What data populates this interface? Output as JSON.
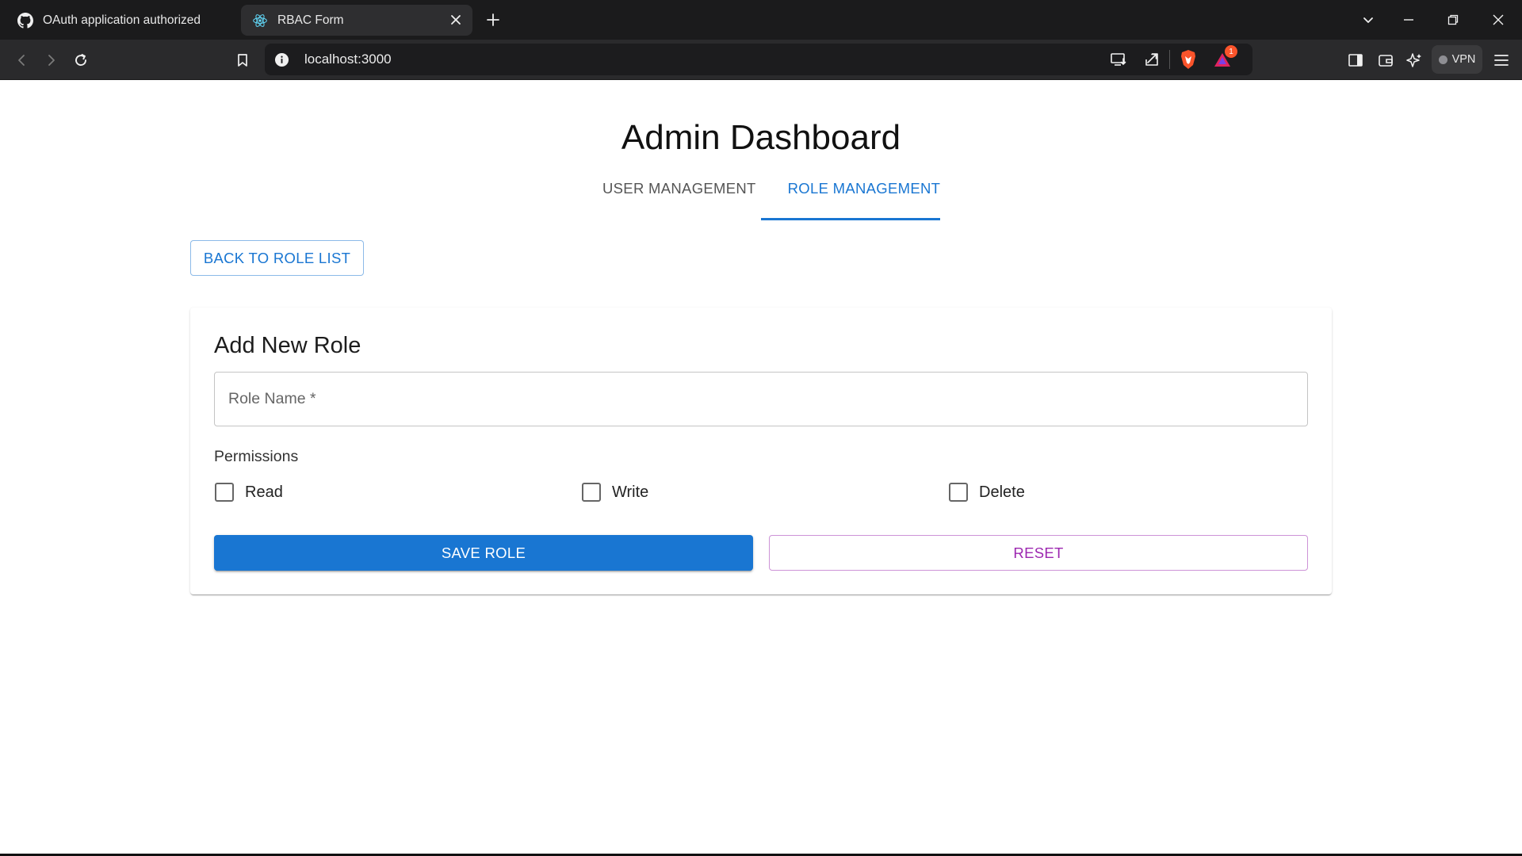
{
  "browser": {
    "tabs": [
      {
        "title": "OAuth application authorized",
        "icon": "github-icon",
        "active": false
      },
      {
        "title": "RBAC Form",
        "icon": "react-icon",
        "active": true
      }
    ],
    "url": "localhost:3000",
    "vpn_label": "VPN",
    "notification_count": "1"
  },
  "page": {
    "title": "Admin Dashboard",
    "tabs": [
      {
        "label": "USER MANAGEMENT",
        "active": false
      },
      {
        "label": "ROLE MANAGEMENT",
        "active": true
      }
    ],
    "back_button": "BACK TO ROLE LIST",
    "form": {
      "title": "Add New Role",
      "role_name_label": "Role Name *",
      "role_name_value": "",
      "permissions_label": "Permissions",
      "permissions": [
        {
          "label": "Read",
          "checked": false
        },
        {
          "label": "Write",
          "checked": false
        },
        {
          "label": "Delete",
          "checked": false
        }
      ],
      "save_button": "SAVE ROLE",
      "reset_button": "RESET"
    }
  },
  "colors": {
    "primary": "#1976d2",
    "secondary": "#9c27b0"
  }
}
